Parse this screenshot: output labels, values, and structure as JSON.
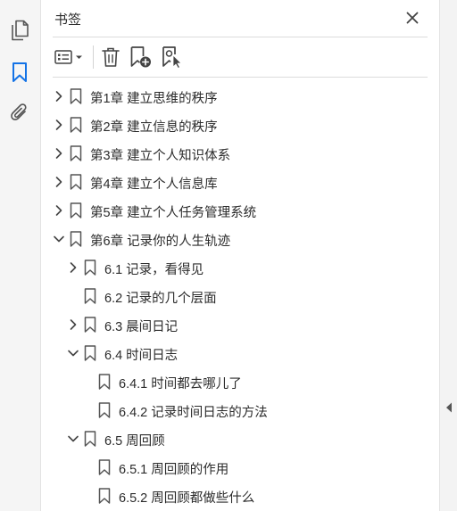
{
  "rail": {
    "icons": [
      "pages-icon",
      "bookmarks-icon",
      "attachments-icon"
    ],
    "active_color": "#1473e6"
  },
  "panel": {
    "title": "书签"
  },
  "toolbar": {
    "buttons": [
      "options-menu-icon",
      "delete-bookmark-icon",
      "new-bookmark-icon",
      "bookmark-from-selection-icon"
    ]
  },
  "bookmarks": [
    {
      "label": "第1章 建立思维的秩序",
      "level": 0,
      "expander": "collapsed"
    },
    {
      "label": "第2章 建立信息的秩序",
      "level": 0,
      "expander": "collapsed"
    },
    {
      "label": "第3章 建立个人知识体系",
      "level": 0,
      "expander": "collapsed"
    },
    {
      "label": "第4章 建立个人信息库",
      "level": 0,
      "expander": "collapsed"
    },
    {
      "label": "第5章 建立个人任务管理系统",
      "level": 0,
      "expander": "collapsed"
    },
    {
      "label": "第6章 记录你的人生轨迹",
      "level": 0,
      "expander": "expanded"
    },
    {
      "label": "6.1 记录，看得见",
      "level": 1,
      "expander": "collapsed"
    },
    {
      "label": "6.2 记录的几个层面",
      "level": 1,
      "expander": "none"
    },
    {
      "label": "6.3 晨间日记",
      "level": 1,
      "expander": "collapsed"
    },
    {
      "label": "6.4 时间日志",
      "level": 1,
      "expander": "expanded"
    },
    {
      "label": "6.4.1 时间都去哪儿了",
      "level": 2,
      "expander": "none"
    },
    {
      "label": "6.4.2 记录时间日志的方法",
      "level": 2,
      "expander": "none"
    },
    {
      "label": "6.5 周回顾",
      "level": 1,
      "expander": "expanded"
    },
    {
      "label": "6.5.1 周回顾的作用",
      "level": 2,
      "expander": "none"
    },
    {
      "label": "6.5.2 周回顾都做些什么",
      "level": 2,
      "expander": "none"
    }
  ]
}
